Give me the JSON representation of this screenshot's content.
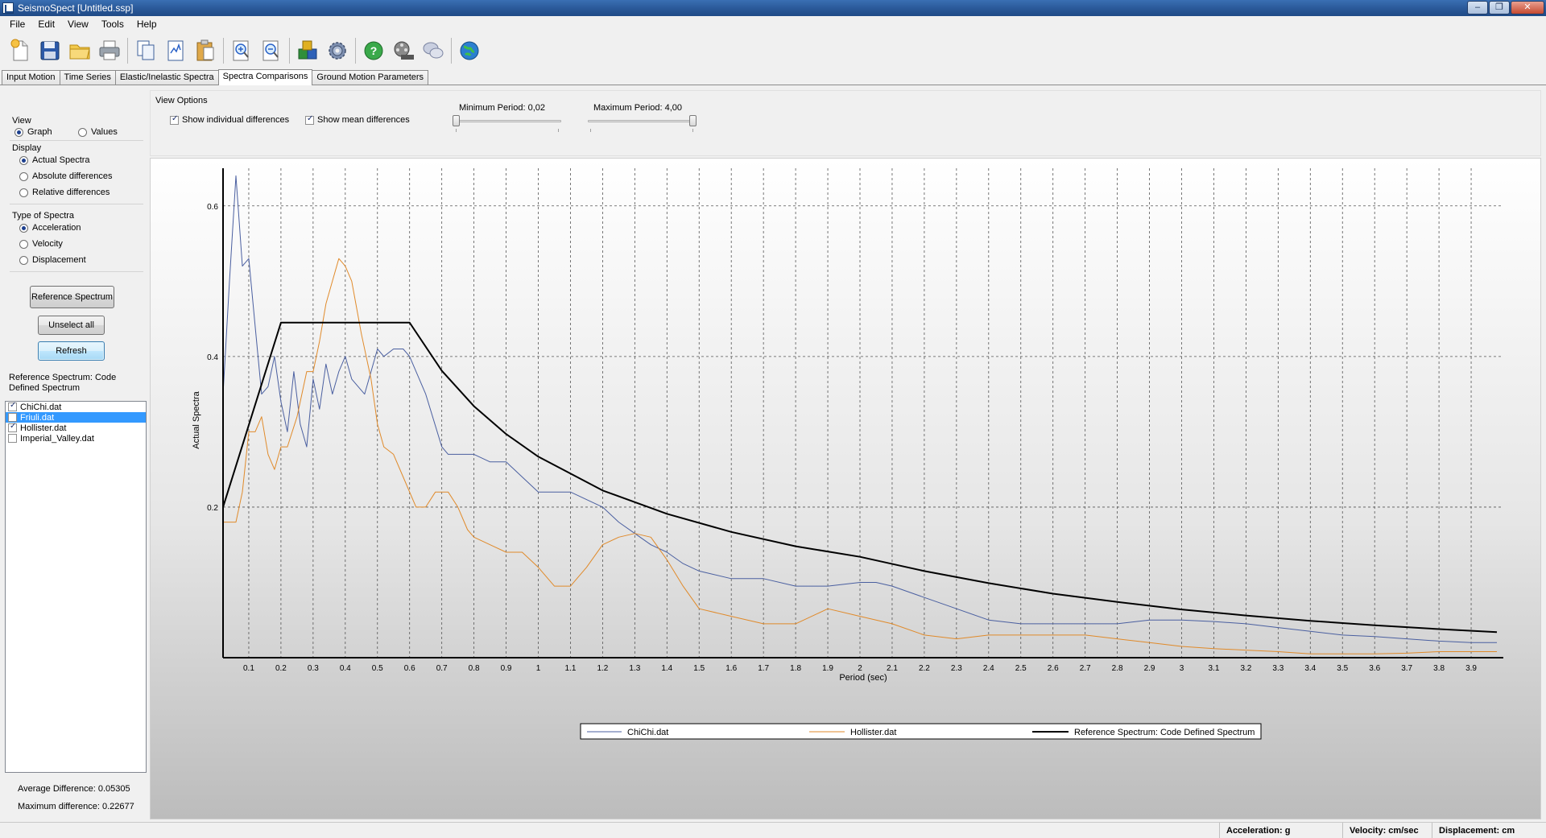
{
  "window": {
    "title": "SeismoSpect  [Untitled.ssp]",
    "controls": {
      "minimize": "–",
      "maximize": "❐",
      "close": "✕"
    }
  },
  "menu": [
    "File",
    "Edit",
    "View",
    "Tools",
    "Help"
  ],
  "toolbar": [
    "new-file-icon",
    "save-icon",
    "open-folder-icon",
    "print-icon",
    "copy-icon",
    "paste-chart-icon",
    "clipboard-icon",
    "zoom-in-icon",
    "zoom-out-icon",
    "package-icon",
    "settings-gear-icon",
    "help-icon",
    "film-reel-icon",
    "chat-icon",
    "globe-icon"
  ],
  "tabs": [
    {
      "label": "Input Motion",
      "active": false
    },
    {
      "label": "Time Series",
      "active": false
    },
    {
      "label": "Elastic/Inelastic Spectra",
      "active": false
    },
    {
      "label": "Spectra Comparisons",
      "active": true
    },
    {
      "label": "Ground Motion Parameters",
      "active": false
    }
  ],
  "left": {
    "view_label": "View",
    "view_graph": "Graph",
    "view_values": "Values",
    "display_label": "Display",
    "display_actual": "Actual Spectra",
    "display_absolute": "Absolute differences",
    "display_relative": "Relative differences",
    "type_label": "Type of Spectra",
    "type_acc": "Acceleration",
    "type_vel": "Velocity",
    "type_disp": "Displacement",
    "btn_reference": "Reference Spectrum",
    "btn_unselect": "Unselect all",
    "btn_refresh": "Refresh",
    "reference_text": "Reference Spectrum: Code Defined Spectrum",
    "files": [
      {
        "name": "ChiChi.dat",
        "checked": true,
        "selected": false
      },
      {
        "name": "Friuli.dat",
        "checked": false,
        "selected": true
      },
      {
        "name": "Hollister.dat",
        "checked": true,
        "selected": false
      },
      {
        "name": "Imperial_Valley.dat",
        "checked": false,
        "selected": false
      }
    ],
    "avg_diff": "Average Difference:  0.05305",
    "max_diff": "Maximum difference:  0.22677"
  },
  "view_options": {
    "title": "View Options",
    "show_individual": "Show individual differences",
    "show_mean": "Show mean differences",
    "min_period_label": "Minimum Period:   0,02",
    "max_period_label": "Maximum Period:   4,00"
  },
  "statusbar": {
    "acc": "Acceleration: g",
    "vel": "Velocity: cm/sec",
    "disp": "Displacement: cm"
  },
  "chart_data": {
    "type": "line",
    "title": "",
    "xlabel": "Period (sec)",
    "ylabel": "Actual Spectra",
    "xlim": [
      0.02,
      4.0
    ],
    "ylim": [
      0.0,
      0.65
    ],
    "x_ticks": [
      "0.1",
      "0.2",
      "0.3",
      "0.4",
      "0.5",
      "0.6",
      "0.7",
      "0.8",
      "0.9",
      "1",
      "1.1",
      "1.2",
      "1.3",
      "1.4",
      "1.5",
      "1.6",
      "1.7",
      "1.8",
      "1.9",
      "2",
      "2.1",
      "2.2",
      "2.3",
      "2.4",
      "2.5",
      "2.6",
      "2.7",
      "2.8",
      "2.9",
      "3",
      "3.1",
      "3.2",
      "3.3",
      "3.4",
      "3.5",
      "3.6",
      "3.7",
      "3.8",
      "3.9"
    ],
    "y_ticks": [
      "0.2",
      "0.4",
      "0.6"
    ],
    "grid": true,
    "legend_position": "bottom",
    "series": [
      {
        "name": "ChiChi.dat",
        "color": "#4a5fa0",
        "x": [
          0.02,
          0.04,
          0.06,
          0.07,
          0.08,
          0.1,
          0.12,
          0.14,
          0.16,
          0.18,
          0.2,
          0.22,
          0.24,
          0.26,
          0.28,
          0.3,
          0.32,
          0.34,
          0.36,
          0.38,
          0.4,
          0.42,
          0.44,
          0.46,
          0.48,
          0.5,
          0.52,
          0.55,
          0.58,
          0.6,
          0.65,
          0.7,
          0.72,
          0.75,
          0.8,
          0.85,
          0.9,
          0.95,
          1.0,
          1.05,
          1.1,
          1.15,
          1.2,
          1.25,
          1.3,
          1.35,
          1.4,
          1.45,
          1.5,
          1.6,
          1.7,
          1.8,
          1.9,
          2.0,
          2.05,
          2.1,
          2.2,
          2.3,
          2.4,
          2.5,
          2.6,
          2.7,
          2.8,
          2.9,
          3.0,
          3.1,
          3.2,
          3.3,
          3.4,
          3.5,
          3.6,
          3.7,
          3.8,
          3.9,
          3.98
        ],
        "y": [
          0.35,
          0.5,
          0.64,
          0.58,
          0.52,
          0.53,
          0.44,
          0.35,
          0.36,
          0.4,
          0.34,
          0.3,
          0.38,
          0.31,
          0.28,
          0.37,
          0.33,
          0.39,
          0.35,
          0.38,
          0.4,
          0.37,
          0.36,
          0.35,
          0.38,
          0.41,
          0.4,
          0.41,
          0.41,
          0.4,
          0.35,
          0.28,
          0.27,
          0.27,
          0.27,
          0.26,
          0.26,
          0.24,
          0.22,
          0.22,
          0.22,
          0.21,
          0.2,
          0.18,
          0.165,
          0.15,
          0.14,
          0.125,
          0.115,
          0.105,
          0.105,
          0.095,
          0.095,
          0.1,
          0.1,
          0.095,
          0.08,
          0.065,
          0.05,
          0.045,
          0.045,
          0.045,
          0.045,
          0.05,
          0.05,
          0.048,
          0.045,
          0.04,
          0.035,
          0.03,
          0.028,
          0.025,
          0.022,
          0.02,
          0.02
        ]
      },
      {
        "name": "Hollister.dat",
        "color": "#e08a2a",
        "x": [
          0.02,
          0.06,
          0.08,
          0.1,
          0.12,
          0.14,
          0.16,
          0.18,
          0.2,
          0.22,
          0.25,
          0.28,
          0.3,
          0.32,
          0.34,
          0.36,
          0.38,
          0.4,
          0.42,
          0.45,
          0.48,
          0.5,
          0.52,
          0.55,
          0.58,
          0.6,
          0.62,
          0.65,
          0.68,
          0.7,
          0.72,
          0.75,
          0.78,
          0.8,
          0.85,
          0.9,
          0.95,
          1.0,
          1.05,
          1.1,
          1.15,
          1.2,
          1.25,
          1.3,
          1.35,
          1.4,
          1.45,
          1.5,
          1.6,
          1.7,
          1.8,
          1.85,
          1.9,
          2.0,
          2.1,
          2.2,
          2.3,
          2.4,
          2.5,
          2.6,
          2.7,
          2.8,
          2.9,
          3.0,
          3.1,
          3.2,
          3.3,
          3.4,
          3.5,
          3.6,
          3.7,
          3.8,
          3.9,
          3.98
        ],
        "y": [
          0.18,
          0.18,
          0.22,
          0.3,
          0.3,
          0.32,
          0.27,
          0.25,
          0.28,
          0.28,
          0.32,
          0.38,
          0.38,
          0.42,
          0.47,
          0.5,
          0.53,
          0.52,
          0.5,
          0.43,
          0.37,
          0.31,
          0.28,
          0.27,
          0.24,
          0.22,
          0.2,
          0.2,
          0.22,
          0.22,
          0.22,
          0.2,
          0.17,
          0.16,
          0.15,
          0.14,
          0.14,
          0.12,
          0.095,
          0.095,
          0.12,
          0.15,
          0.16,
          0.165,
          0.16,
          0.13,
          0.095,
          0.065,
          0.055,
          0.045,
          0.045,
          0.055,
          0.065,
          0.055,
          0.045,
          0.03,
          0.025,
          0.03,
          0.03,
          0.03,
          0.03,
          0.025,
          0.02,
          0.015,
          0.012,
          0.01,
          0.008,
          0.005,
          0.005,
          0.005,
          0.006,
          0.008,
          0.008,
          0.008
        ]
      },
      {
        "name": "Reference Spectrum: Code Defined Spectrum",
        "color": "#000000",
        "x": [
          0.02,
          0.2,
          0.6,
          0.7,
          0.8,
          0.9,
          1.0,
          1.2,
          1.4,
          1.6,
          1.8,
          2.0,
          2.2,
          2.4,
          2.6,
          2.8,
          3.0,
          3.2,
          3.4,
          3.6,
          3.8,
          3.98
        ],
        "y": [
          0.2,
          0.445,
          0.445,
          0.381,
          0.334,
          0.297,
          0.267,
          0.222,
          0.191,
          0.167,
          0.148,
          0.134,
          0.115,
          0.099,
          0.085,
          0.074,
          0.064,
          0.056,
          0.049,
          0.043,
          0.038,
          0.034
        ]
      }
    ]
  }
}
